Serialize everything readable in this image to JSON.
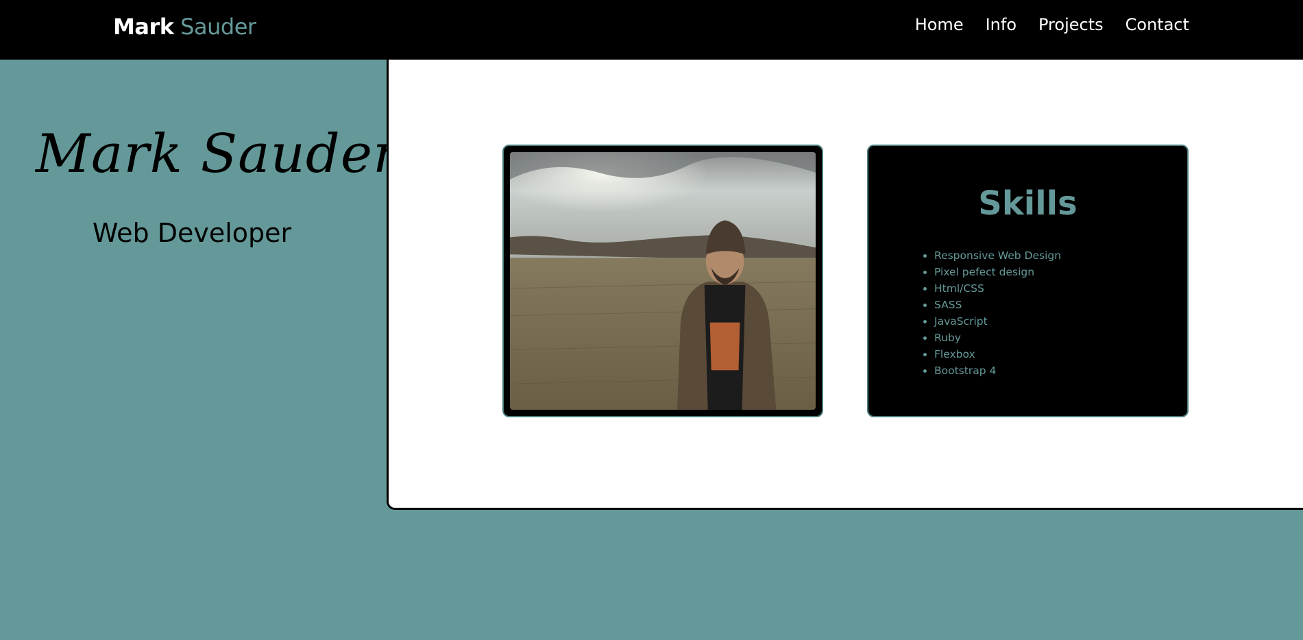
{
  "nav": {
    "brand_first": "Mark",
    "brand_last": "Sauder",
    "links": [
      {
        "label": "Home"
      },
      {
        "label": "Info"
      },
      {
        "label": "Projects"
      },
      {
        "label": "Contact"
      }
    ]
  },
  "hero": {
    "script_name": "Mark Sauder",
    "role": "Web Developer"
  },
  "photo": {
    "icon": "profile-photo"
  },
  "skills": {
    "title": "Skills",
    "items": [
      "Responsive Web Design",
      "Pixel pefect design",
      "Html/CSS",
      "SASS",
      "JavaScript",
      "Ruby",
      "Flexbox",
      "Bootstrap 4"
    ]
  },
  "colors": {
    "accent": "#659999",
    "navbar": "#000000",
    "panel": "#ffffff"
  }
}
